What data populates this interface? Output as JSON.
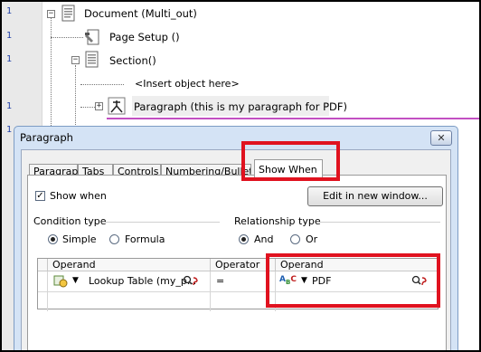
{
  "gutter": {
    "line_numbers": [
      "1",
      "1",
      "1",
      "1",
      "1"
    ]
  },
  "tree": {
    "document": {
      "label": "Document (Multi_out)",
      "expander": "−"
    },
    "page_setup": {
      "label": "Page Setup ()"
    },
    "section": {
      "label": "Section()",
      "expander": "−"
    },
    "insert_placeholder": {
      "label": "<Insert object here>"
    },
    "paragraph": {
      "label": "Paragraph (this is my paragraph for PDF)",
      "expander": "+"
    }
  },
  "dialog": {
    "title": "Paragraph",
    "close_label": "✕",
    "tabs": [
      {
        "label": "Paragraph"
      },
      {
        "label": "Tabs"
      },
      {
        "label": "Controls"
      },
      {
        "label": "Numbering/Bullet"
      },
      {
        "label": "Show When"
      }
    ],
    "show_when": {
      "label": "Show when",
      "checked": "✓"
    },
    "edit_button": "Edit in new window...",
    "condition_type": {
      "label": "Condition type",
      "options": [
        {
          "label": "Simple"
        },
        {
          "label": "Formula"
        }
      ]
    },
    "relationship_type": {
      "label": "Relationship type",
      "options": [
        {
          "label": "And"
        },
        {
          "label": "Or"
        }
      ]
    },
    "grid": {
      "headers": [
        "Operand",
        "Operator",
        "Operand"
      ],
      "row": {
        "operand1": "Lookup Table (my_p...",
        "operator": "=",
        "operand2": "PDF"
      }
    }
  },
  "colors": {
    "highlight": "#e0121f",
    "separator": "#c24fc2",
    "dialog_frame": "#d4e3f5"
  }
}
